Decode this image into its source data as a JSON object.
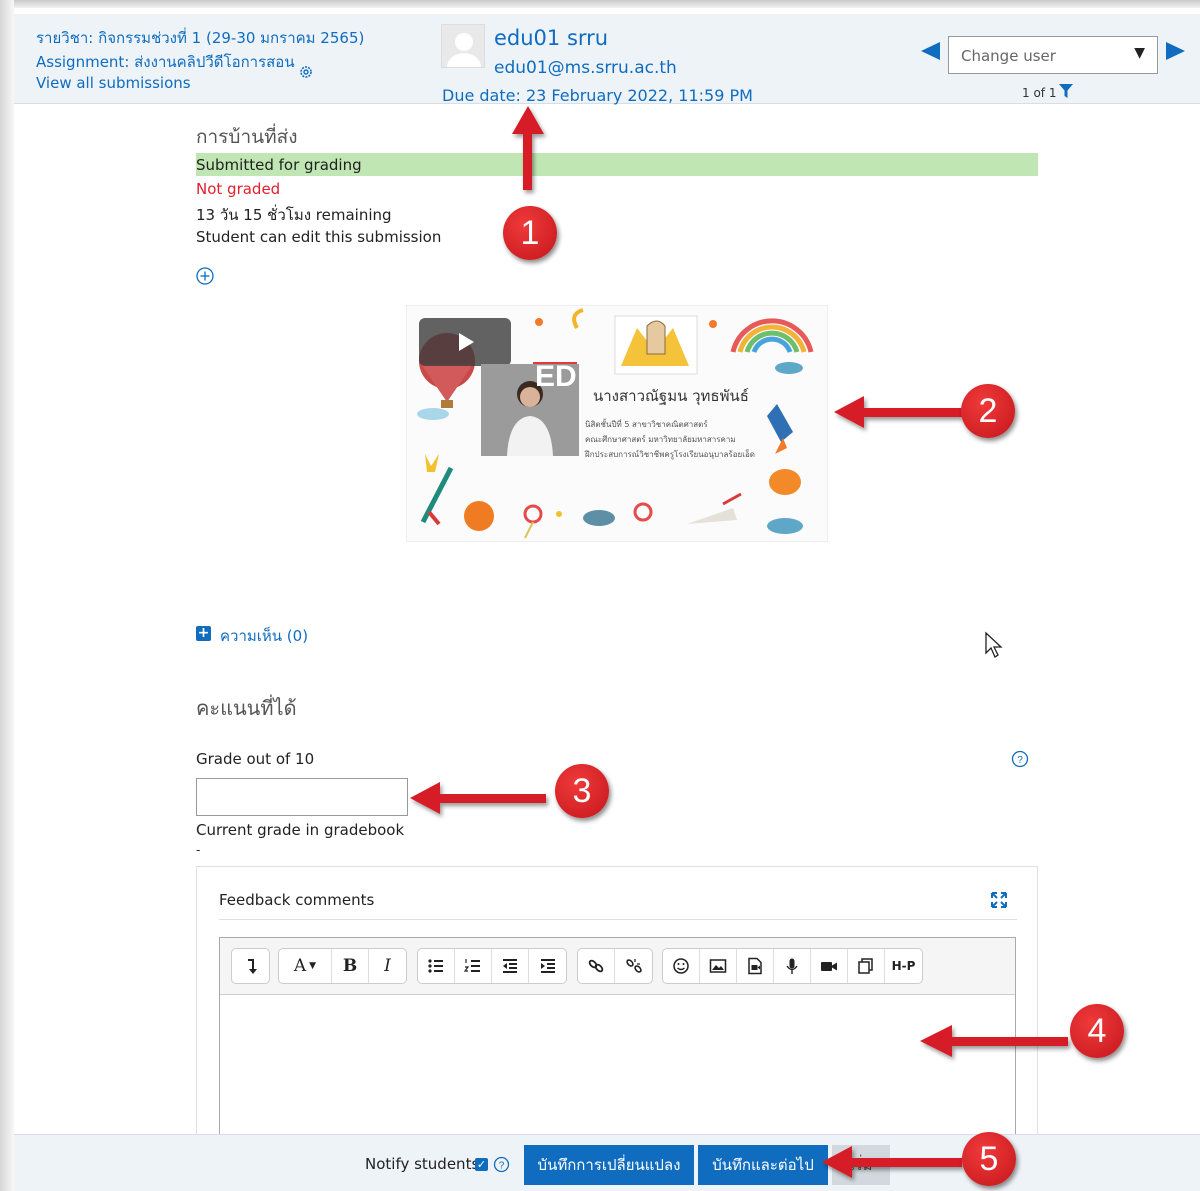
{
  "header": {
    "course": "รายวิชา: กิจกรรมช่วงที่ 1 (29-30 มกราคม 2565)",
    "assignment": "Assignment: ส่งงานคลิปวีดีโอการสอน",
    "view_all": "View all submissions",
    "user_name": "edu01 srru",
    "user_email": "edu01@ms.srru.ac.th",
    "due_date": "Due date: 23 February 2022, 11:59 PM",
    "change_user": "Change user",
    "page_count": "1 of 1"
  },
  "submission": {
    "section_title": "การบ้านที่ส่ง",
    "status": "Submitted for grading",
    "grading_status": "Not graded",
    "time_remaining": "13 วัน 15 ชั่วโมง remaining",
    "edit_note": "Student can edit this submission"
  },
  "video": {
    "name": "นางสาวณัฐมน วุทธพันธ์",
    "lines": [
      "นิสิตชั้นปีที่ 5 สาขาวิชาคณิตศาสตร์",
      "คณะศึกษาศาสตร์ มหาวิทยาลัยมหาสารคาม",
      "ฝึกประสบการณ์วิชาชีพครูโรงเรียนอนุบาลร้อยเอ็ด"
    ],
    "logo_letters": "ED"
  },
  "comments": {
    "label": "ความเห็น (0)"
  },
  "grade": {
    "section_title": "คะแนนที่ได้",
    "grade_label": "Grade out of 10",
    "grade_value": "",
    "current_label": "Current grade in gradebook",
    "current_value": "-"
  },
  "feedback": {
    "title": "Feedback comments",
    "toolbar": {
      "font_label": "A",
      "bold_label": "B",
      "italic_label": "I",
      "h5p_label": "H-P"
    }
  },
  "footer": {
    "notify_label": "Notify students",
    "notify_checked": true,
    "save_label": "บันทึกการเปลี่ยนแปลง",
    "save_next_label": "บันทึกและต่อไป",
    "reset_label": "เริ่ม"
  },
  "annotations": [
    "1",
    "2",
    "3",
    "4",
    "5"
  ],
  "colors": {
    "link": "#0f6cbf",
    "status_ok": "#bfe6b3",
    "status_bad": "#e3202c",
    "callout": "#d61f26"
  }
}
